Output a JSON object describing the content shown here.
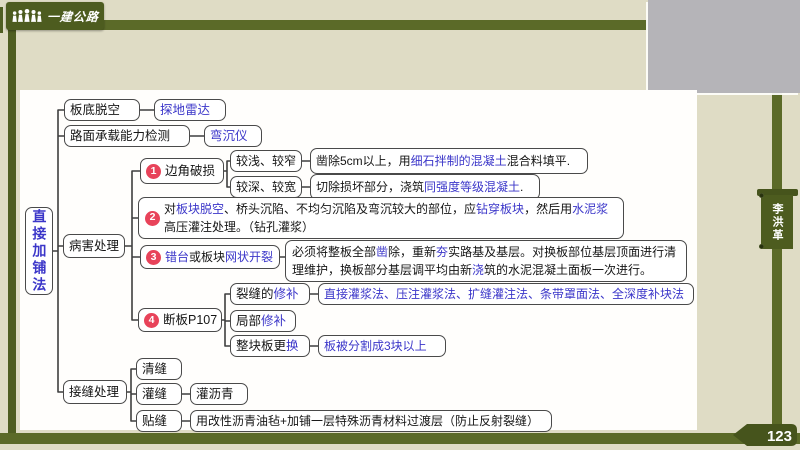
{
  "page": {
    "brand": "一建公路",
    "author": "李洪革",
    "page_number": "123"
  },
  "colors": {
    "olive_dark": "#4d5c1f",
    "olive": "#5b6a28",
    "beige_background": "#dfdcc5",
    "camera_gray": "#b5b4b8",
    "highlight_blue": "#3b36c9",
    "marker_red": "#e8435a"
  },
  "mindmap": {
    "root": "直接加铺法",
    "nodes": {
      "slab_void": {
        "label": "板底脱空"
      },
      "slab_void_tool": {
        "segments": [
          {
            "t": "探地雷达",
            "c": "b"
          }
        ]
      },
      "capacity": {
        "label": "路面承载能力检测"
      },
      "capacity_tool": {
        "segments": [
          {
            "t": "弯沉仪",
            "c": "b"
          }
        ]
      },
      "disease": {
        "label": "病害处理"
      },
      "d1": {
        "num": "1",
        "segments": [
          {
            "t": "边角破损"
          }
        ]
      },
      "d1a": {
        "label": "较浅、较窄"
      },
      "d1a_detail": {
        "segments": [
          {
            "t": "凿除5cm以上，用"
          },
          {
            "t": "细石拌制的混凝土",
            "c": "b"
          },
          {
            "t": "混合料填平."
          }
        ]
      },
      "d1b": {
        "label": "较深、较宽"
      },
      "d1b_detail": {
        "segments": [
          {
            "t": "切除损坏部分，浇筑"
          },
          {
            "t": "同强度等级混凝土",
            "c": "b"
          },
          {
            "t": "."
          }
        ]
      },
      "d2": {
        "num": "2",
        "segments": [
          {
            "t": "对"
          },
          {
            "t": "板块脱空",
            "c": "b"
          },
          {
            "t": "、桥头沉陷、不均匀沉陷及弯沉较大的部位，应"
          },
          {
            "t": "钻穿板块",
            "c": "b"
          },
          {
            "t": "，然后用"
          },
          {
            "t": "水泥浆",
            "c": "b"
          },
          {
            "t": "高压灌注处理。（钻孔灌浆）"
          }
        ]
      },
      "d3": {
        "num": "3",
        "segments": [
          {
            "t": "错台",
            "c": "b"
          },
          {
            "t": "或板块"
          },
          {
            "t": "网状开裂",
            "c": "b"
          }
        ]
      },
      "d3_detail": {
        "segments": [
          {
            "t": "必须将整板全部"
          },
          {
            "t": "凿",
            "c": "b"
          },
          {
            "t": "除，重新"
          },
          {
            "t": "夯",
            "c": "b"
          },
          {
            "t": "实路基及基层。对换板部位基层顶面进行清理维护，换板部分基层调平均由新"
          },
          {
            "t": "浇",
            "c": "b"
          },
          {
            "t": "筑的水泥混凝土面板一次进行。"
          }
        ]
      },
      "d4": {
        "num": "4",
        "segments": [
          {
            "t": "断板P107"
          }
        ]
      },
      "d4a": {
        "segments": [
          {
            "t": "裂缝的"
          },
          {
            "t": "修补",
            "c": "b"
          }
        ]
      },
      "d4a_detail": {
        "segments": [
          {
            "t": "直接灌浆法、压注灌浆法、扩缝灌注法、条带罩面法、全深度补块法",
            "c": "b"
          }
        ]
      },
      "d4b": {
        "segments": [
          {
            "t": "局部"
          },
          {
            "t": "修补",
            "c": "b"
          }
        ]
      },
      "d4c": {
        "segments": [
          {
            "t": "整块板更"
          },
          {
            "t": "换",
            "c": "b"
          }
        ]
      },
      "d4c_detail": {
        "segments": [
          {
            "t": "板被分割成3块以上",
            "c": "b"
          }
        ]
      },
      "joint": {
        "label": "接缝处理"
      },
      "j1": {
        "label": "清缝"
      },
      "j2": {
        "label": "灌缝"
      },
      "j2_detail": {
        "label": "灌沥青"
      },
      "j3": {
        "label": "贴缝"
      },
      "j3_detail": {
        "label": "用改性沥青油毡+加铺一层特殊沥青材料过渡层（防止反射裂缝）"
      }
    }
  }
}
